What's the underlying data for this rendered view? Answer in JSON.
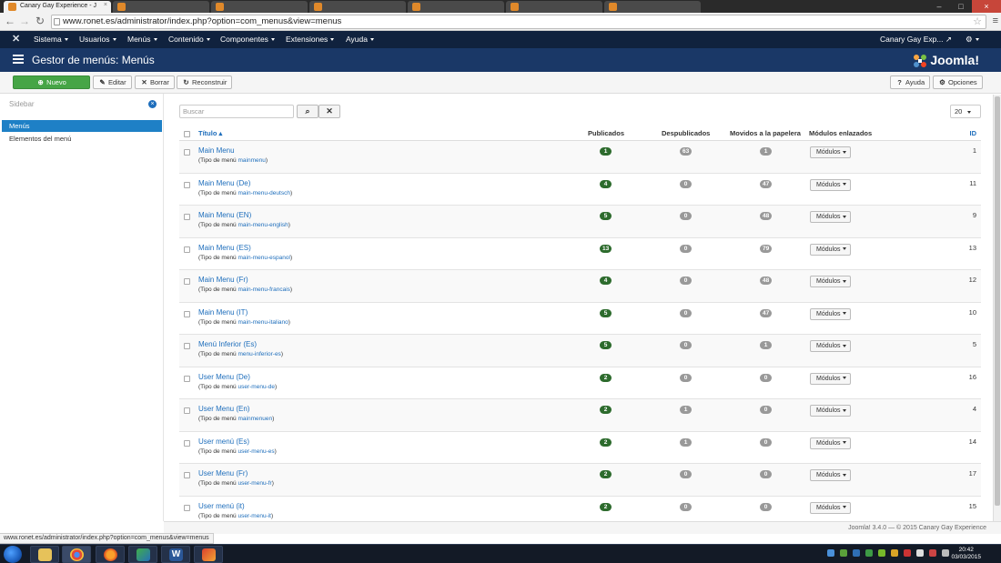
{
  "browser": {
    "tabs": [
      {
        "label": "Canary Gay Experience - J",
        "active": true
      },
      {
        "label": "",
        "active": false
      },
      {
        "label": "",
        "active": false
      },
      {
        "label": "",
        "active": false
      },
      {
        "label": "",
        "active": false
      },
      {
        "label": "",
        "active": false
      },
      {
        "label": "",
        "active": false
      }
    ],
    "url": "www.ronet.es/administrator/index.php?option=com_menus&view=menus",
    "status_url": "www.ronet.es/administrator/index.php?option=com_menus&view=menus"
  },
  "topnav": {
    "items": [
      "Sistema",
      "Usuarios",
      "Menús",
      "Contenido",
      "Componentes",
      "Extensiones",
      "Ayuda"
    ],
    "site_name": "Canary Gay Exp..."
  },
  "header": {
    "title": "Gestor de menús: Menús",
    "logo_text": "Joomla!"
  },
  "toolbar": {
    "new_label": "Nuevo",
    "edit_label": "Editar",
    "delete_label": "Borrar",
    "rebuild_label": "Reconstruir",
    "help_label": "Ayuda",
    "options_label": "Opciones"
  },
  "sidebar": {
    "label": "Sidebar",
    "items": [
      {
        "label": "Menús",
        "active": true
      },
      {
        "label": "Elementos del menú",
        "active": false
      }
    ]
  },
  "filter": {
    "search_placeholder": "Buscar",
    "limit": "20"
  },
  "table": {
    "headers": {
      "title": "Título",
      "published": "Publicados",
      "unpublished": "Despublicados",
      "trashed": "Movidos a la papelera",
      "modules": "Módulos enlazados",
      "id": "ID"
    },
    "type_prefix": "(Tipo de menú",
    "type_suffix": ")",
    "modules_label": "Módulos",
    "rows": [
      {
        "title": "Main Menu",
        "type": "mainmenu",
        "published": "1",
        "unpublished": "63",
        "trashed": "1",
        "id": "1"
      },
      {
        "title": "Main Menu (De)",
        "type": "main-menu-deutsch",
        "published": "4",
        "unpublished": "0",
        "trashed": "47",
        "id": "11"
      },
      {
        "title": "Main Menu (EN)",
        "type": "main-menu-english",
        "published": "5",
        "unpublished": "0",
        "trashed": "48",
        "id": "9"
      },
      {
        "title": "Main Menu (ES)",
        "type": "main-menu-espanol",
        "published": "13",
        "unpublished": "0",
        "trashed": "79",
        "id": "13"
      },
      {
        "title": "Main Menu (Fr)",
        "type": "main-menu-francais",
        "published": "4",
        "unpublished": "0",
        "trashed": "48",
        "id": "12"
      },
      {
        "title": "Main Menu (IT)",
        "type": "main-menu-italiano",
        "published": "5",
        "unpublished": "0",
        "trashed": "47",
        "id": "10"
      },
      {
        "title": "Menú Inferior (Es)",
        "type": "menu-inferior-es",
        "published": "5",
        "unpublished": "0",
        "trashed": "1",
        "id": "5"
      },
      {
        "title": "User Menu (De)",
        "type": "user-menu-de",
        "published": "2",
        "unpublished": "0",
        "trashed": "0",
        "id": "16"
      },
      {
        "title": "User Menu (En)",
        "type": "mainmenuen",
        "published": "2",
        "unpublished": "1",
        "trashed": "0",
        "id": "4"
      },
      {
        "title": "User menú (Es)",
        "type": "user-menu-es",
        "published": "2",
        "unpublished": "1",
        "trashed": "0",
        "id": "14"
      },
      {
        "title": "User Menu (Fr)",
        "type": "user-menu-fr",
        "published": "2",
        "unpublished": "0",
        "trashed": "0",
        "id": "17"
      },
      {
        "title": "User menú (it)",
        "type": "user-menu-it",
        "published": "2",
        "unpublished": "0",
        "trashed": "0",
        "id": "15"
      }
    ]
  },
  "footer": {
    "text": "Joomla! 3.4.0 — © 2015 Canary Gay Experience"
  },
  "taskbar": {
    "time": "20:42",
    "date": "03/03/2015"
  },
  "colors": {
    "nav_bg": "#10223e",
    "header_bg": "#1a3867",
    "link": "#1e6ebc",
    "published_badge": "#2d6b2d",
    "new_button": "#46a546",
    "active_sidebar": "#1e80c6"
  },
  "icons": {
    "joomla": "joomla-logo-icon",
    "list": "list-icon",
    "search": "search-icon",
    "clear": "clear-icon",
    "gear": "gear-icon",
    "help": "help-icon",
    "edit": "edit-icon",
    "delete": "delete-icon",
    "rebuild": "refresh-icon"
  }
}
